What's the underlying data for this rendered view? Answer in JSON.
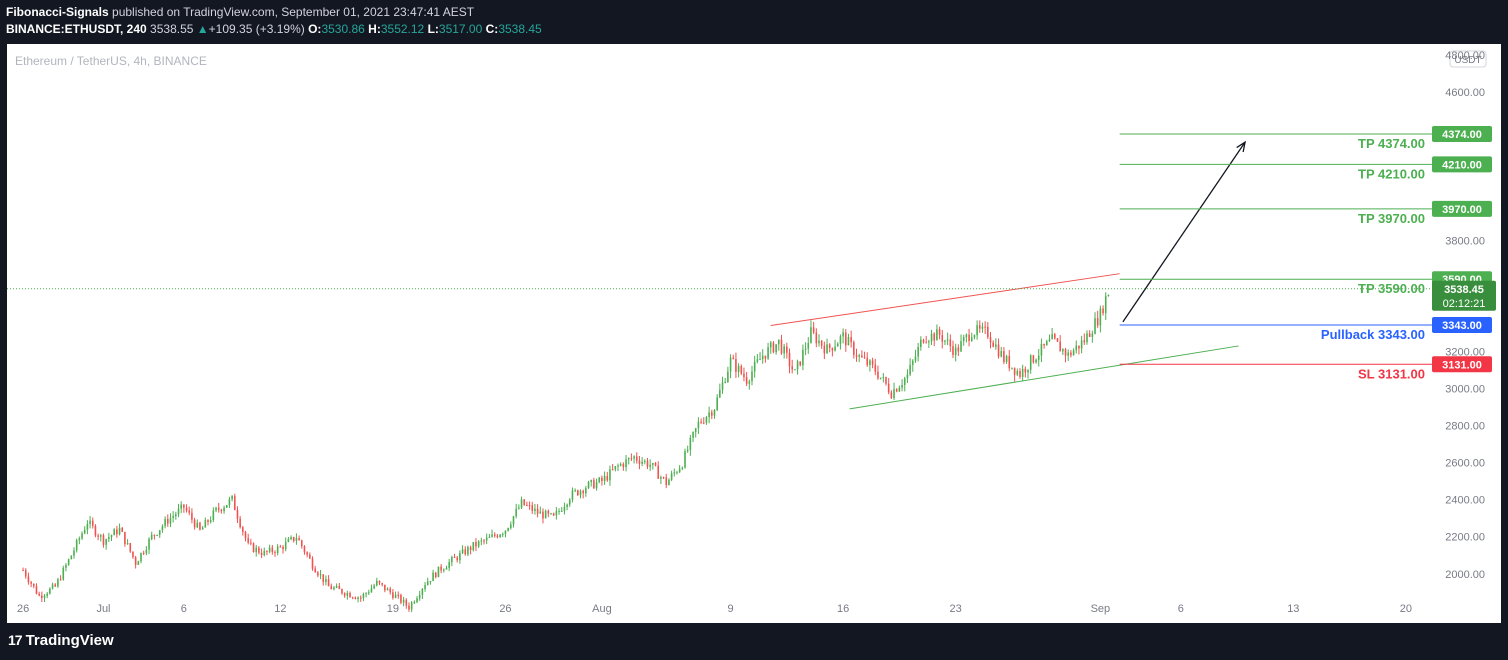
{
  "header": {
    "publisher": "Fibonacci-Signals",
    "published_text": "published on TradingView.com, September 01, 2021 23:47:41 AEST",
    "symbol": "BINANCE:ETHUSDT, 240",
    "last": "3538.55",
    "change": "+109.35 (+3.19%)",
    "o_label": "O:",
    "o": "3530.86",
    "h_label": "H:",
    "h": "3552.12",
    "l_label": "L:",
    "l": "3517.00",
    "c_label": "C:",
    "c": "3538.45"
  },
  "chart_title": "Ethereum / TetherUS, 4h, BINANCE",
  "currency_badge": "USDT",
  "footer": {
    "brand": "TradingView",
    "logo_glyph": "17"
  },
  "colors": {
    "background": "#131722",
    "panel": "#ffffff",
    "up": "#26a69a",
    "up_candle": "#4caf50",
    "down_candle": "#ef5350",
    "tp": "#4caf50",
    "pullback": "#2962ff",
    "sl": "#f23645",
    "axis_text": "#787b86"
  },
  "chart_data": {
    "type": "candlestick",
    "y_ticks": [
      2000,
      2200,
      2400,
      2600,
      2800,
      3000,
      3200,
      3800,
      4600,
      4800
    ],
    "ylim": [
      1880,
      4860
    ],
    "x_ticks": [
      {
        "day": 0,
        "label": "26"
      },
      {
        "day": 5,
        "label": "Jul"
      },
      {
        "day": 10,
        "label": "6"
      },
      {
        "day": 16,
        "label": "12"
      },
      {
        "day": 23,
        "label": "19"
      },
      {
        "day": 30,
        "label": "26"
      },
      {
        "day": 36,
        "label": "Aug"
      },
      {
        "day": 44,
        "label": "9"
      },
      {
        "day": 51,
        "label": "16"
      },
      {
        "day": 58,
        "label": "23"
      },
      {
        "day": 67,
        "label": "Sep"
      },
      {
        "day": 72,
        "label": "6"
      },
      {
        "day": 79,
        "label": "13"
      },
      {
        "day": 86,
        "label": "20"
      }
    ],
    "xlim": [
      -1,
      87.5
    ],
    "price_path": [
      [
        0,
        2020
      ],
      [
        1,
        1880
      ],
      [
        2,
        1930
      ],
      [
        3,
        2100
      ],
      [
        4,
        2280
      ],
      [
        5,
        2180
      ],
      [
        6,
        2240
      ],
      [
        7,
        2060
      ],
      [
        8,
        2200
      ],
      [
        9,
        2290
      ],
      [
        10,
        2360
      ],
      [
        11,
        2230
      ],
      [
        12,
        2340
      ],
      [
        13,
        2400
      ],
      [
        14,
        2150
      ],
      [
        15,
        2110
      ],
      [
        16,
        2140
      ],
      [
        17,
        2200
      ],
      [
        18,
        2050
      ],
      [
        19,
        1930
      ],
      [
        20,
        1900
      ],
      [
        21,
        1870
      ],
      [
        22,
        1950
      ],
      [
        23,
        1890
      ],
      [
        24,
        1820
      ],
      [
        25,
        1950
      ],
      [
        26,
        2030
      ],
      [
        27,
        2090
      ],
      [
        28,
        2150
      ],
      [
        29,
        2190
      ],
      [
        30,
        2240
      ],
      [
        31,
        2380
      ],
      [
        32,
        2330
      ],
      [
        33,
        2300
      ],
      [
        34,
        2420
      ],
      [
        35,
        2470
      ],
      [
        36,
        2500
      ],
      [
        37,
        2580
      ],
      [
        38,
        2630
      ],
      [
        39,
        2590
      ],
      [
        40,
        2490
      ],
      [
        41,
        2600
      ],
      [
        42,
        2810
      ],
      [
        43,
        2900
      ],
      [
        44,
        3150
      ],
      [
        45,
        3050
      ],
      [
        46,
        3180
      ],
      [
        47,
        3250
      ],
      [
        48,
        3080
      ],
      [
        49,
        3300
      ],
      [
        50,
        3210
      ],
      [
        51,
        3280
      ],
      [
        52,
        3170
      ],
      [
        53,
        3100
      ],
      [
        54,
        2980
      ],
      [
        55,
        3070
      ],
      [
        56,
        3280
      ],
      [
        57,
        3290
      ],
      [
        58,
        3200
      ],
      [
        59,
        3310
      ],
      [
        60,
        3300
      ],
      [
        61,
        3160
      ],
      [
        62,
        3080
      ],
      [
        63,
        3180
      ],
      [
        64,
        3260
      ],
      [
        65,
        3180
      ],
      [
        66,
        3260
      ],
      [
        67,
        3400
      ],
      [
        67.3,
        3480
      ],
      [
        67.6,
        3540
      ]
    ],
    "levels": [
      {
        "label": "TP 4374.00",
        "value": 4374.0,
        "tag": "4374.00",
        "kind": "tp"
      },
      {
        "label": "TP 4210.00",
        "value": 4210.0,
        "tag": "4210.00",
        "kind": "tp"
      },
      {
        "label": "TP 3970.00",
        "value": 3970.0,
        "tag": "3970.00",
        "kind": "tp"
      },
      {
        "label": "TP 3590.00",
        "value": 3590.0,
        "tag": "3590.00",
        "kind": "tp"
      },
      {
        "label": "Pullback 3343.00",
        "value": 3343.0,
        "tag": "3343.00",
        "kind": "pullback"
      },
      {
        "label": "SL 3131.00",
        "value": 3131.0,
        "tag": "3131.00",
        "kind": "sl"
      }
    ],
    "levels_start_day": 68.2,
    "levels_end_day": 88.6,
    "current_price": {
      "value": 3538.45,
      "tag": "3538.45",
      "countdown": "02:12:21"
    },
    "channel_upper": [
      [
        46.5,
        3340
      ],
      [
        68.2,
        3620
      ]
    ],
    "channel_lower": [
      [
        51.4,
        2890
      ],
      [
        75.6,
        3230
      ]
    ],
    "arrow": [
      [
        68.4,
        3360
      ],
      [
        76.0,
        4330
      ]
    ]
  }
}
